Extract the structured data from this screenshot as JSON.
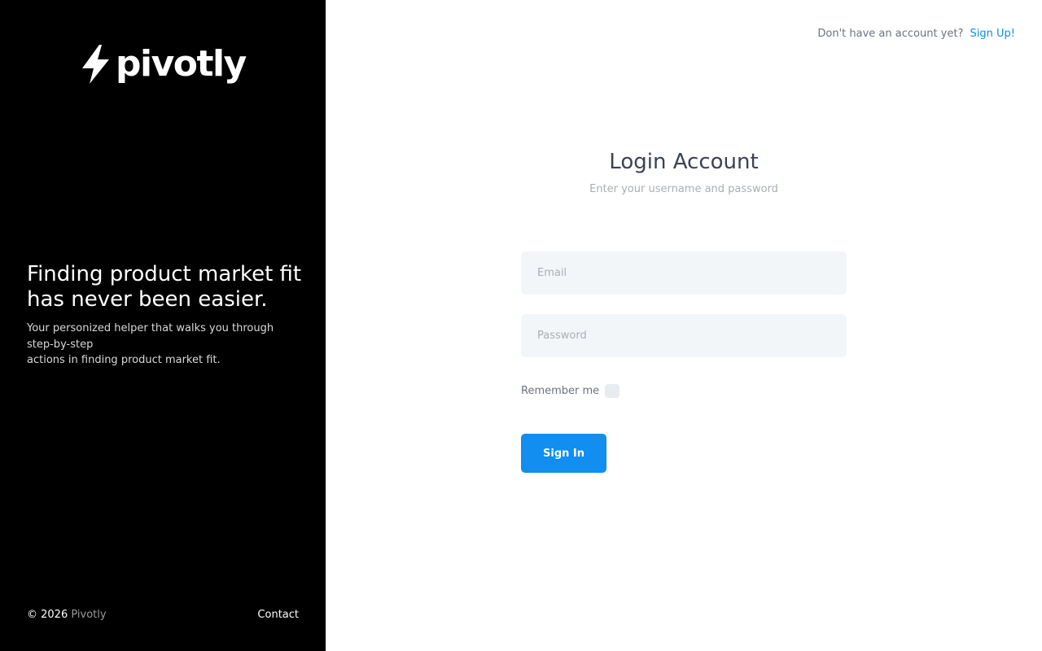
{
  "brand": {
    "name": "pivotly",
    "logo_icon": "lightning-bolt-icon"
  },
  "tagline": {
    "heading_line1": "Finding product market fit",
    "heading_line2": "has never been easier.",
    "sub_line1": "Your personized helper that walks you through step-by-step",
    "sub_line2": "actions in finding product market fit."
  },
  "footer": {
    "copyright_prefix": "© 2026",
    "copyright_brand": "Pivotly",
    "contact_label": "Contact"
  },
  "header": {
    "signup_prompt": "Don't have an account yet?",
    "signup_link": "Sign Up!"
  },
  "login": {
    "title": "Login Account",
    "subtitle": "Enter your username and password",
    "email_placeholder": "Email",
    "email_value": "",
    "password_placeholder": "Password",
    "password_value": "",
    "remember_label": "Remember me",
    "remember_checked": false,
    "signin_label": "Sign In"
  },
  "colors": {
    "left_panel_bg": "#000000",
    "accent": "#118ef0",
    "link": "#0b8fe4",
    "input_bg": "#f3f6f9",
    "title_text": "#3b4253"
  }
}
